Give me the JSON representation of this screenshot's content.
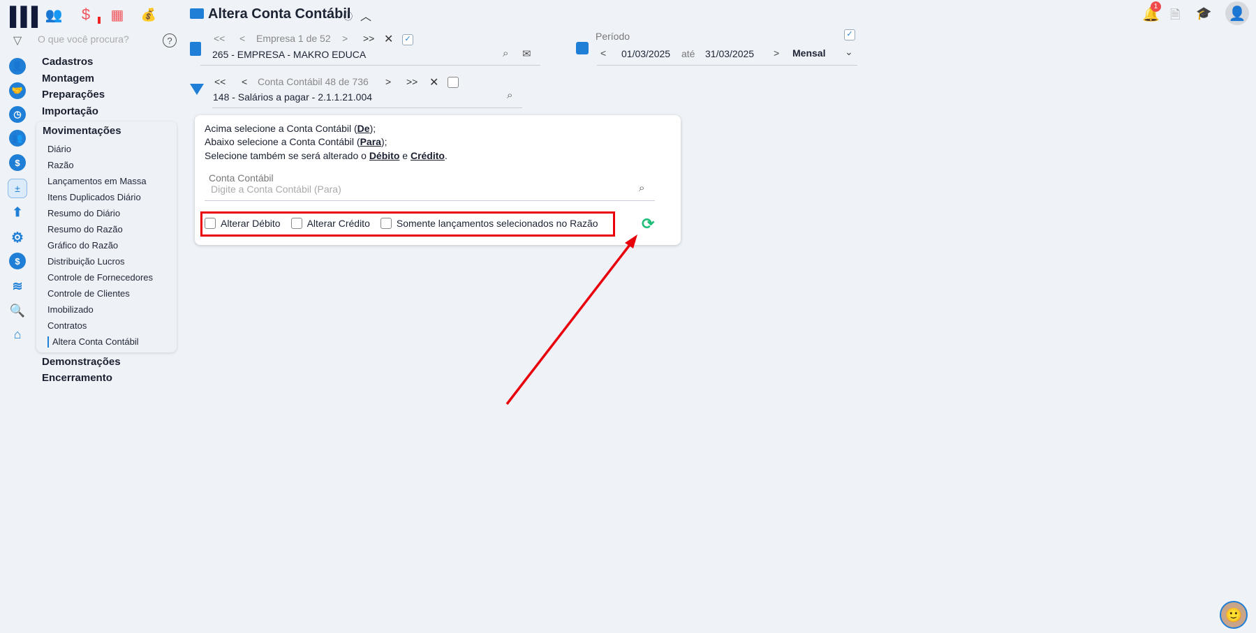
{
  "header": {
    "title": "Altera Conta Contábil",
    "info_icon": "ⓘ"
  },
  "search": {
    "placeholder": "O que você procura?"
  },
  "menu": {
    "top": [
      "Cadastros",
      "Montagem",
      "Preparações",
      "Importação"
    ],
    "active_group": "Movimentações",
    "items": [
      "Diário",
      "Razão",
      "Lançamentos em Massa",
      "Itens Duplicados Diário",
      "Resumo do Diário",
      "Resumo do Razão",
      "Gráfico do Razão",
      "Distribuição Lucros",
      "Controle de Fornecedores",
      "Controle de Clientes",
      "Imobilizado",
      "Contratos",
      "Altera Conta Contábil"
    ],
    "bottom": [
      "Demonstrações",
      "Encerramento"
    ]
  },
  "empresa": {
    "nav": "Empresa 1 de 52",
    "value": "265 - EMPRESA - MAKRO EDUCA"
  },
  "conta": {
    "nav": "Conta Contábil 48 de 736",
    "value": "148 - Salários a pagar - 2.1.1.21.004"
  },
  "periodo": {
    "label": "Período",
    "from": "01/03/2025",
    "sep": "até",
    "to": "31/03/2025",
    "mode": "Mensal"
  },
  "card": {
    "l1a": "Acima selecione a Conta Contábil (",
    "l1b": "De",
    "l1c": ");",
    "l2a": "Abaixo selecione a Conta Contábil (",
    "l2b": "Para",
    "l2c": ");",
    "l3a": "Selecione também se será alterado o ",
    "l3b": "Débito",
    "l3c": " e ",
    "l3d": "Crédito",
    "l3e": ".",
    "field_label": "Conta Contábil",
    "field_placeholder": "Digite a Conta Contábil (Para)",
    "cb1": "Alterar Débito",
    "cb2": "Alterar Crédito",
    "cb3": "Somente lançamentos selecionados no Razão"
  },
  "notifications": {
    "count": "1"
  },
  "colors": {
    "accent": "#1f7fd6",
    "annotation": "#e8000b",
    "refresh": "#1fbf7a"
  }
}
